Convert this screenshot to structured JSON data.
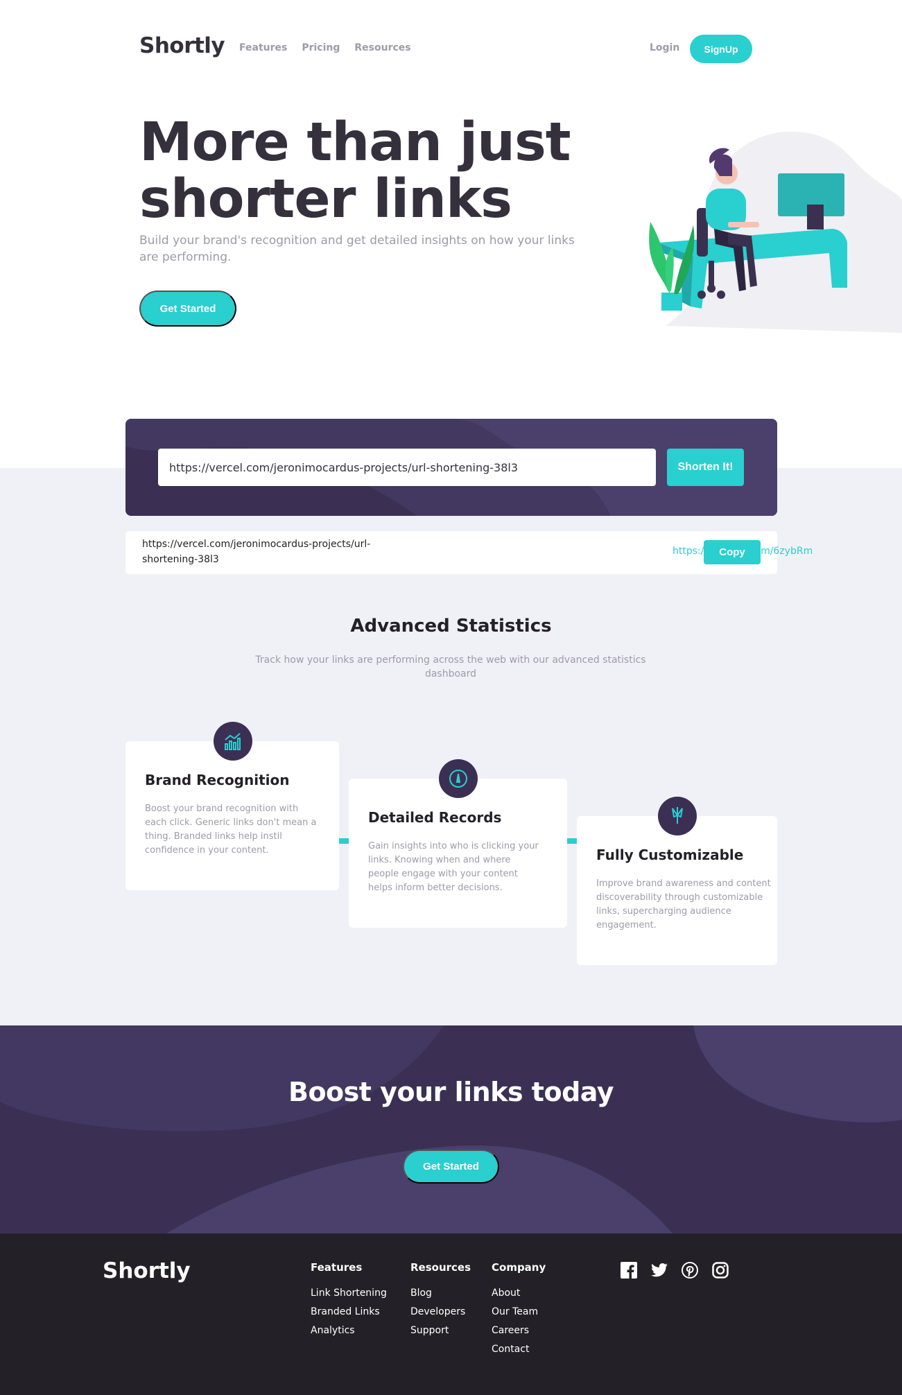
{
  "brand": {
    "name": "Shortly",
    "accent": "#2acfcf",
    "dark_violet": "#3b3054"
  },
  "header": {
    "nav": [
      "Features",
      "Pricing",
      "Resources"
    ],
    "login": "Login",
    "signup": "SignUp"
  },
  "hero": {
    "title": "More than just shorter links",
    "subtitle": "Build your brand's recognition and get detailed insights on how your links are performing.",
    "cta": "Get Started"
  },
  "shortener": {
    "input_value": "https://vercel.com/jeronimocardus-projects/url-shortening-38l3",
    "button": "Shorten It!"
  },
  "result": {
    "original": "https://vercel.com/jeronimocardus-projects/url-shortening-38l3",
    "short": "https://cleanuri.com/6zybRm",
    "copy": "Copy"
  },
  "statistics": {
    "title": "Advanced Statistics",
    "subtitle": "Track how your links are performing across the web with our advanced statistics dashboard",
    "cards": [
      {
        "icon": "chart-icon",
        "title": "Brand Recognition",
        "text": "Boost your brand recognition with each click. Generic links don't mean a thing. Branded links help instil confidence in your content."
      },
      {
        "icon": "gauge-icon",
        "title": "Detailed Records",
        "text": "Gain insights into who is clicking your links. Knowing when and where people engage with your content helps inform better decisions."
      },
      {
        "icon": "brush-icon",
        "title": "Fully Customizable",
        "text": "Improve brand awareness and content discoverability through customizable links, supercharging audience engagement."
      }
    ]
  },
  "boost": {
    "title": "Boost your links today",
    "cta": "Get Started"
  },
  "footer": {
    "columns": [
      {
        "title": "Features",
        "links": [
          "Link Shortening",
          "Branded Links",
          "Analytics"
        ]
      },
      {
        "title": "Resources",
        "links": [
          "Blog",
          "Developers",
          "Support"
        ]
      },
      {
        "title": "Company",
        "links": [
          "About",
          "Our Team",
          "Careers",
          "Contact"
        ]
      }
    ],
    "social": [
      "facebook-icon",
      "twitter-icon",
      "pinterest-icon",
      "instagram-icon"
    ]
  }
}
